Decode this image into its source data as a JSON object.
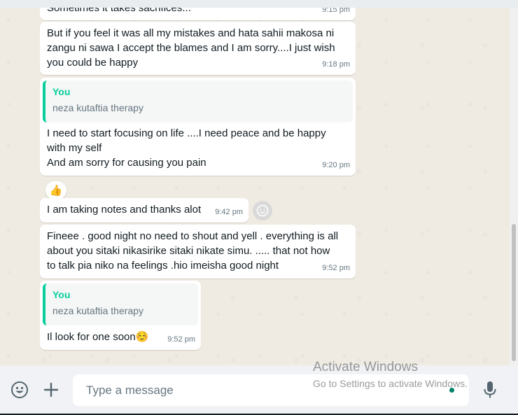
{
  "messages": [
    {
      "text": "Sometimes it takes sacrifices...",
      "time": "9:15 pm"
    },
    {
      "text": "But if you feel it was all my mistakes and hata sahii makosa ni\nzangu ni sawa I accept the blames and I am sorry....I just wish\nyou could be happy",
      "time": "9:18 pm"
    },
    {
      "quote_name": "You",
      "quote_text": "neza kutaftia therapy",
      "text": "I need to start focusing on life ....I need peace and be happy\nwith my self\nAnd am sorry for causing you pain",
      "time": "9:20 pm",
      "reaction": "👍"
    },
    {
      "text": "I am taking notes and thanks alot",
      "time": "9:42 pm"
    },
    {
      "text": "Fineee . good night no need to shout and yell . everything is all\nabout you sitaki nikasirike sitaki nikate simu. ..... that not how\nto talk pia niko na feelings .hio imeisha good night",
      "time": "9:52 pm"
    },
    {
      "quote_name": "You",
      "quote_text": "neza kutaftia therapy",
      "text": "Il look for one soon☺️",
      "time": "9:52 pm"
    }
  ],
  "composer": {
    "placeholder": "Type a message"
  },
  "watermark": {
    "title": "Activate Windows",
    "subtitle": "Go to Settings to activate Windows."
  },
  "colors": {
    "background": "#efeae2",
    "bubble": "#ffffff",
    "accent": "#06cf9c",
    "footer": "#f0f2f5",
    "time": "#667781"
  },
  "icons": [
    "emoji-icon",
    "plus-icon",
    "microphone-icon",
    "smiley-reaction-icon"
  ]
}
